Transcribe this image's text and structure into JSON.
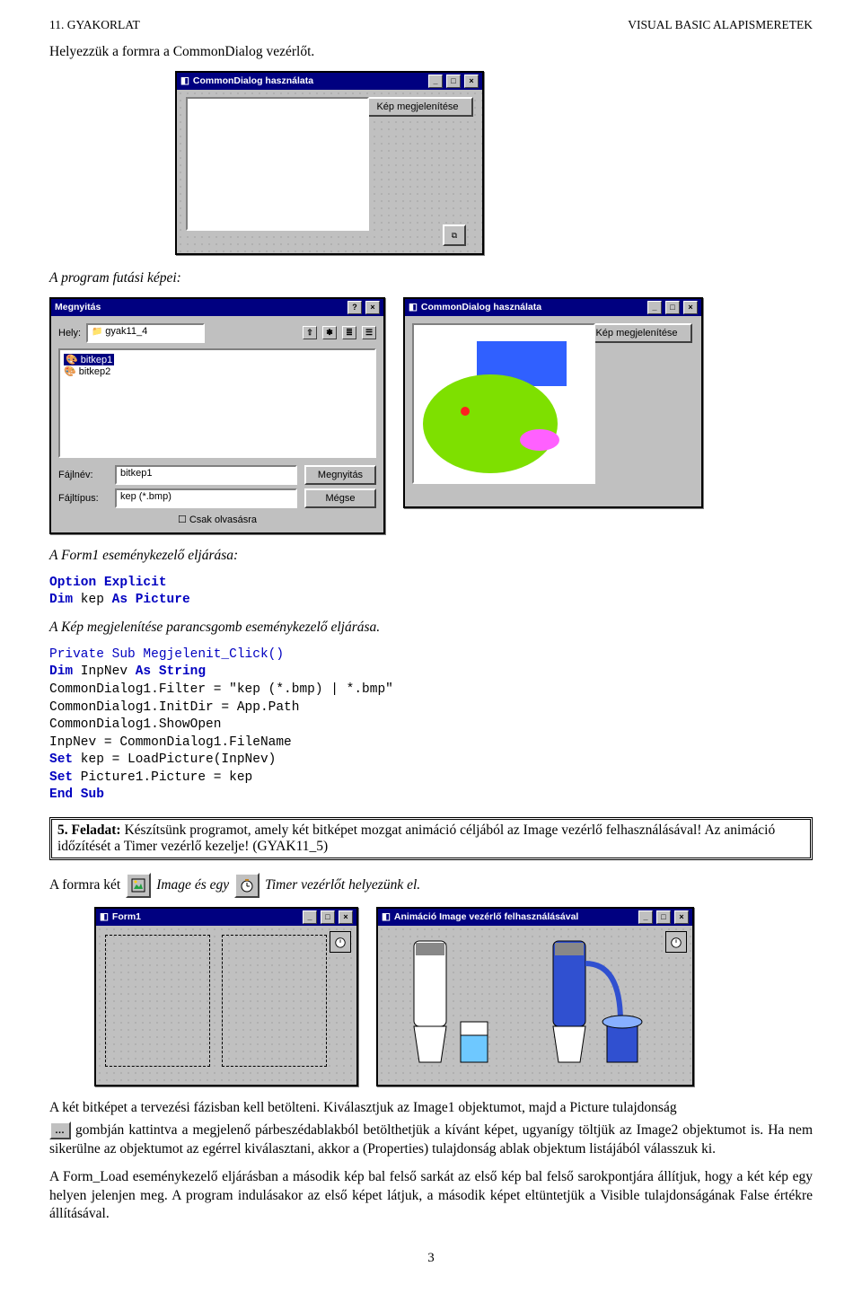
{
  "header": {
    "left": "11. GYAKORLAT",
    "right": "VISUAL BASIC ALAPISMERETEK"
  },
  "p1": "Helyezzük a formra a CommonDialog vezérlőt.",
  "p2": "A program futási képei:",
  "p3": "A Form1 eseménykezelő eljárása:",
  "p4": "A Kép megjelenítése parancsgomb eseménykezelő eljárása.",
  "code1": {
    "l1a": "Option Explicit",
    "l1b": "Dim",
    "l1c": " kep ",
    "l1d": "As Picture"
  },
  "code2": {
    "l1": "Private Sub Megjelenit_Click()",
    "l2a": "Dim",
    "l2b": " InpNev ",
    "l2c": "As String",
    "l3": "CommonDialog1.Filter = \"kep (*.bmp) | *.bmp\"",
    "l4": "CommonDialog1.InitDir = App.Path",
    "l5": "CommonDialog1.ShowOpen",
    "l6": "InpNev = CommonDialog1.FileName",
    "l7a": "Set",
    "l7b": " kep = LoadPicture(InpNev)",
    "l8a": "Set",
    "l8b": " Picture1.Picture = kep",
    "l9": "End Sub"
  },
  "task": {
    "lead": "5. Feladat: ",
    "body": "Készítsünk programot, amely két bitképet mozgat animáció céljából az Image vezérlő felhasználásával! Az animáció időzítését a Timer vezérlő kezelje! (GYAK11_5)"
  },
  "inline": {
    "t1": "A formra két ",
    "t2": " Image  és egy ",
    "t3": " Timer  vezérlőt helyezünk el."
  },
  "paraA": "A két bitképet a tervezési fázisban kell betölteni. Kiválasztjuk az Image1 objektumot, majd a Picture tulajdonság",
  "paraA2": " gombján kattintva a megjelenő párbeszédablakból betölthetjük a kívánt képet, ugyanígy töltjük az Image2 objektumot is. Ha nem sikerülne az objektumot az egérrel kiválasztani, akkor a (Properties) tulajdonság ablak objektum listájából válasszuk ki.",
  "paraB": "A Form_Load eseménykezelő eljárásban a második kép bal felső sarkát az első kép bal felső sarokpontjára állítjuk, hogy a két kép egy helyen jelenjen meg. A program indulásakor az első képet látjuk, a második képet eltüntetjük a Visible tulajdonságának False értékre állításával.",
  "footer": "3",
  "figs": {
    "design1": {
      "title": "CommonDialog használata",
      "btn": "Kép megjelenítése"
    },
    "open": {
      "title": "Megnyitás",
      "helyLabel": "Hely:",
      "hely": "gyak11_4",
      "items": [
        "bitkep1",
        "bitkep2"
      ],
      "fajlnevLabel": "Fájlnév:",
      "fajlnev": "bitkep1",
      "fajltipusLabel": "Fájltípus:",
      "fajltipus": "kep (*.bmp)",
      "open": "Megnyitás",
      "cancel": "Mégse",
      "readonly": "Csak olvasásra"
    },
    "running": {
      "title": "CommonDialog használata",
      "btn": "Kép megjelenítése"
    },
    "form1": {
      "title": "Form1"
    },
    "anim": {
      "title": "Animáció Image vezérlő felhasználásával"
    }
  }
}
